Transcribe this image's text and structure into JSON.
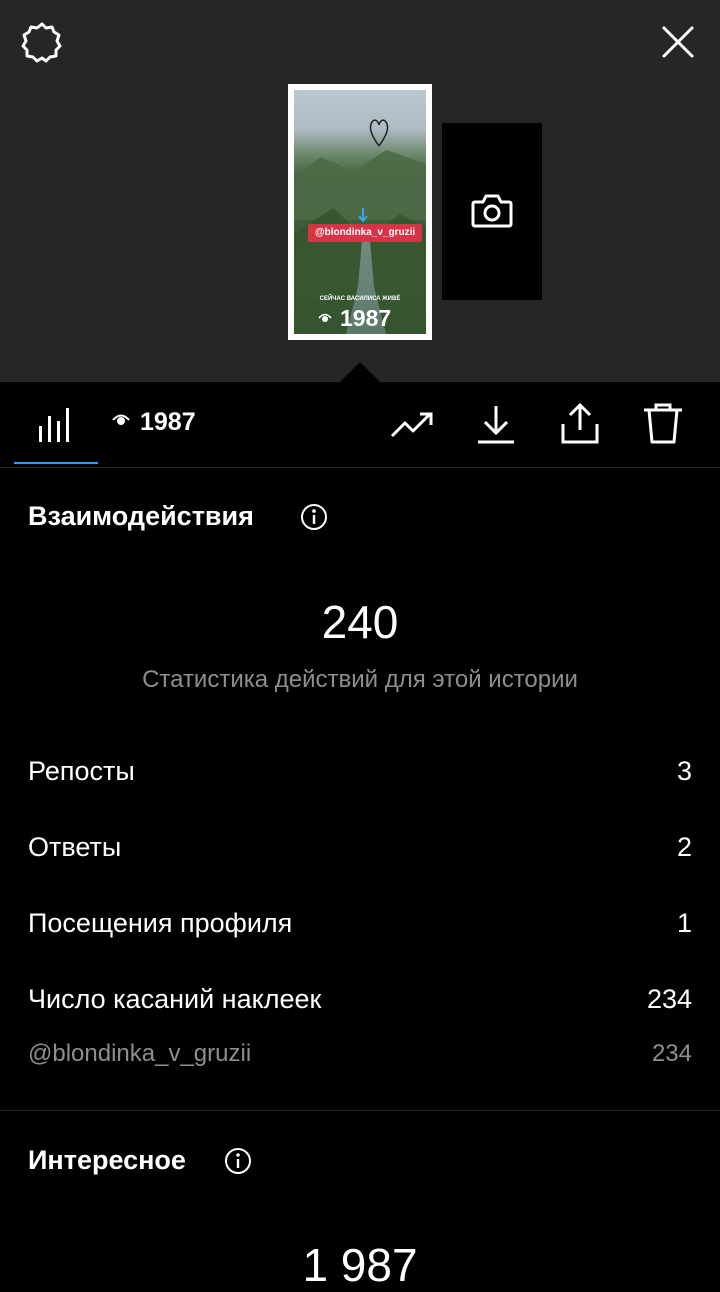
{
  "header": {
    "settings_icon": "gear-icon",
    "close_icon": "close-icon"
  },
  "story": {
    "mention": "@blondinka_v_gruzii",
    "caption": "СЕЙЧАС ВАСИЛИСА ЖИВЁ",
    "views": "1987"
  },
  "toolbar": {
    "views": "1987",
    "icons": [
      "bar-chart-icon",
      "eye-icon",
      "trending-icon",
      "download-icon",
      "share-icon",
      "trash-icon"
    ],
    "accent": "#3897f0"
  },
  "interactions": {
    "title": "Взаимодействия",
    "total": "240",
    "subtitle": "Статистика действий для этой истории",
    "rows": [
      {
        "label": "Репосты",
        "value": "3"
      },
      {
        "label": "Ответы",
        "value": "2"
      },
      {
        "label": "Посещения профиля",
        "value": "1"
      },
      {
        "label": "Число касаний наклеек",
        "value": "234"
      }
    ],
    "sub_row": {
      "label": "@blondinka_v_gruzii",
      "value": "234"
    }
  },
  "discovery": {
    "title": "Интересное",
    "total": "1 987"
  }
}
